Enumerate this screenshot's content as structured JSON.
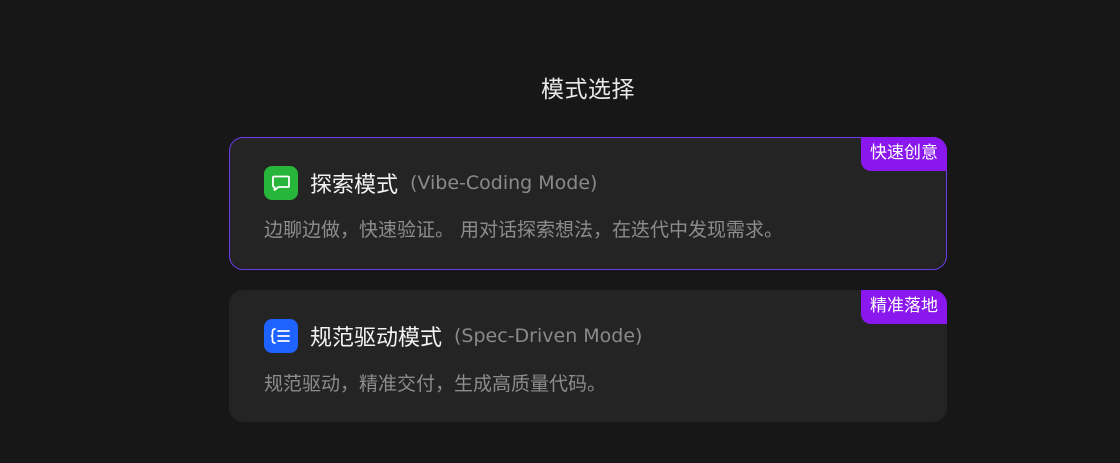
{
  "page": {
    "title": "模式选择"
  },
  "modes": [
    {
      "tag": "快速创意",
      "name": "探索模式",
      "subtitle": "(Vibe-Coding Mode)",
      "description": "边聊边做，快速验证。 用对话探索想法，在迭代中发现需求。",
      "icon": "chat-bubble-icon",
      "icon_color": "#27b53a",
      "selected": true
    },
    {
      "tag": "精准落地",
      "name": "规范驱动模式",
      "subtitle": "(Spec-Driven Mode)",
      "description": "规范驱动，精准交付，生成高质量代码。",
      "icon": "list-spec-icon",
      "icon_color": "#1e63ff",
      "selected": false
    }
  ],
  "colors": {
    "background": "#171717",
    "card": "#242424",
    "tag": "#8a18ee",
    "selected_border": "#6b3df0"
  }
}
